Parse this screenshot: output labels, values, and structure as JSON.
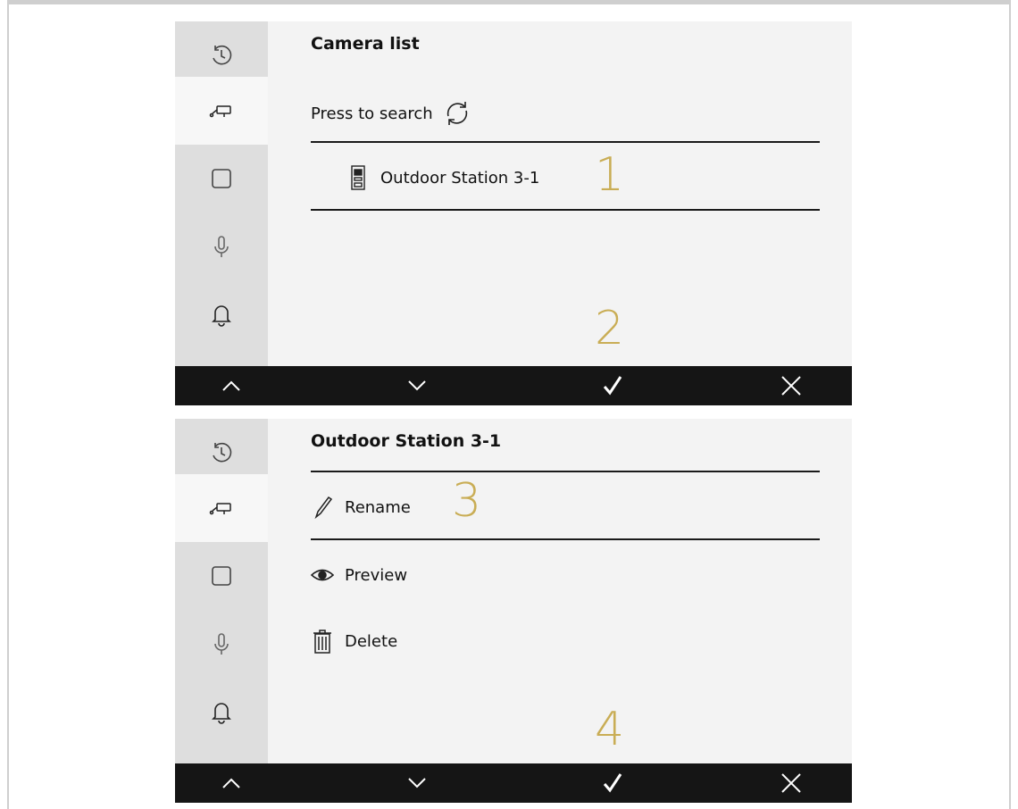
{
  "screen1": {
    "title": "Camera list",
    "search_label": "Press to search",
    "list_item": "Outdoor Station 3-1",
    "callout_a": "1",
    "callout_b": "2"
  },
  "screen2": {
    "title": "Outdoor Station 3-1",
    "menu": [
      "Rename",
      "Preview",
      "Delete"
    ],
    "callout_a": "3",
    "callout_b": "4"
  },
  "sidebar_icons": [
    "history-icon",
    "camera-icon",
    "square-icon",
    "microphone-icon",
    "bell-icon"
  ],
  "bottom_bar_icons": [
    "chevron-up-icon",
    "chevron-down-icon",
    "checkmark-icon",
    "close-icon"
  ],
  "colors": {
    "callout": "#c9ad55",
    "bottom_bar": "#151515",
    "sidebar": "#dedede",
    "screen_bg": "#f3f3f3"
  }
}
